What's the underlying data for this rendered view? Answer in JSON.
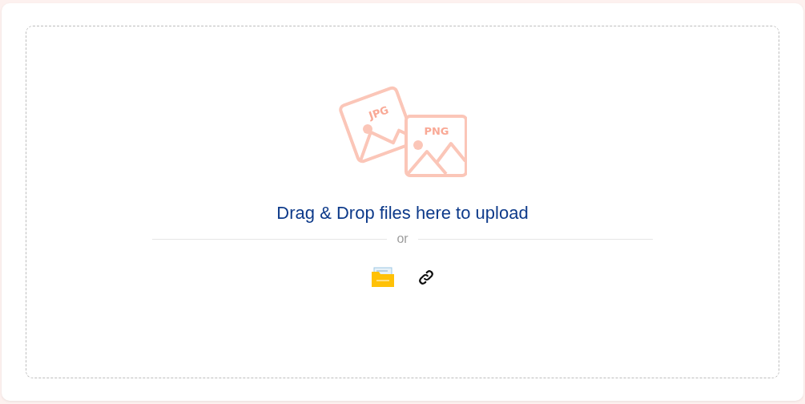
{
  "upload": {
    "icon_labels": [
      "JPG",
      "PNG"
    ],
    "heading": "Drag & Drop files here to upload",
    "separator": "or",
    "sources": [
      {
        "kind": "folder"
      },
      {
        "kind": "link"
      }
    ]
  }
}
